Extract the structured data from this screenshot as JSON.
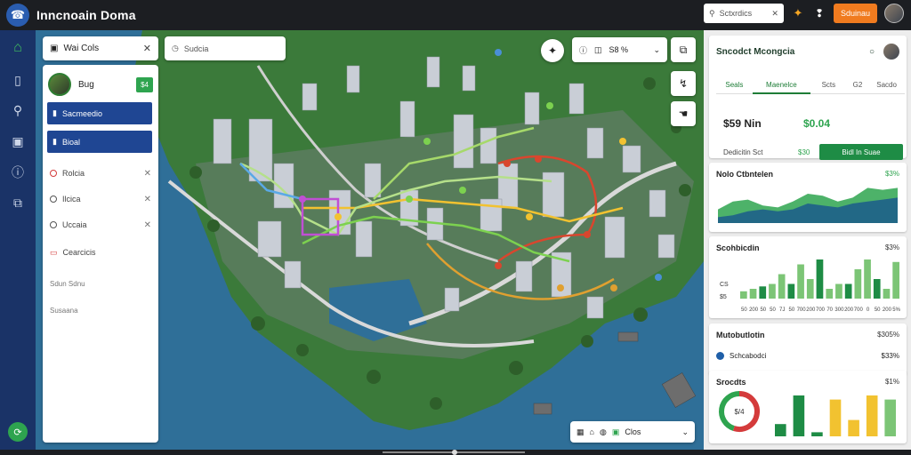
{
  "app": {
    "title": "Inncnoain Doma",
    "logo_icon": "☎"
  },
  "topbar": {
    "search_placeholder": "Sctxrdics",
    "cta_label": "Sduinau",
    "accent": "#f07b1f"
  },
  "rail": {
    "items": [
      {
        "name": "home-icon",
        "glyph": "⌂"
      },
      {
        "name": "book-icon",
        "glyph": "▯"
      },
      {
        "name": "route-icon",
        "glyph": "⚲"
      },
      {
        "name": "wallet-icon",
        "glyph": "▣"
      },
      {
        "name": "info-icon",
        "glyph": "ⓘ"
      },
      {
        "name": "layers-icon",
        "glyph": "⧉"
      }
    ],
    "bottom_glyph": "⟳"
  },
  "tab1": {
    "label": "Wai Cols"
  },
  "tab2": {
    "label": "Sudcia"
  },
  "sidepanel": {
    "user_name": "Bug",
    "user_badge": "$4",
    "nav": [
      "Sacmeedio",
      "Bioal"
    ],
    "layers": [
      "Rolcia",
      "Ilcica",
      "Uccaia"
    ],
    "special_item": "Cearcicis",
    "notes": [
      "Sdun Sdnu",
      "Susaana"
    ]
  },
  "mapctrl": {
    "label": "S8 %"
  },
  "layerbar": {
    "label": "Clos"
  },
  "rightpanel": {
    "title": "Sncodct Mcongcia",
    "tabs": [
      "Seals",
      "Maenelce",
      "Scts",
      "G2",
      "Sacdo"
    ],
    "kpis": {
      "left_value": "$59 Nin",
      "right_value": "$0.04",
      "left_label": "Dedicitin Sct",
      "right_label": "$30"
    },
    "action_label": "Bidl In Suae",
    "area_card": {
      "title": "Nolo Ctbntelen",
      "value": "$3%"
    },
    "bar_card": {
      "title": "Scohbicdin",
      "value": "$3%"
    },
    "mid_card": {
      "title": "Mutobutlotin",
      "value": "$305%",
      "legend_label": "Schcabodci",
      "legend_value": "$33%"
    },
    "donut_card": {
      "title": "Srocdts",
      "value": "$1%",
      "donut_label": "$/4"
    }
  },
  "chart_data": [
    {
      "type": "area",
      "series": [
        {
          "values": [
            0.35,
            0.55,
            0.6,
            0.45,
            0.4,
            0.55,
            0.75,
            0.7,
            0.55,
            0.65,
            0.9,
            0.85,
            0.9
          ]
        },
        {
          "values": [
            0.15,
            0.2,
            0.3,
            0.35,
            0.3,
            0.35,
            0.5,
            0.45,
            0.4,
            0.5,
            0.55,
            0.6,
            0.65
          ]
        }
      ]
    },
    {
      "type": "bar",
      "categories": [
        "50",
        "200",
        "50",
        "50",
        "7J",
        "50",
        "700",
        "200",
        "700",
        "70",
        "300",
        "200",
        "700",
        "0",
        "50",
        "200",
        "5%"
      ],
      "values": [
        3,
        4,
        5,
        6,
        10,
        6,
        14,
        8,
        16,
        4,
        6,
        6,
        12,
        16,
        8,
        4,
        15
      ],
      "side_labels": [
        "CS",
        "$5"
      ]
    },
    {
      "type": "bar",
      "values": [
        3,
        10,
        1,
        9,
        4,
        10,
        9
      ],
      "colors": [
        "#1e8c45",
        "#1e8c45",
        "#1e8c45",
        "#f2c230",
        "#f2c230",
        "#f2c230",
        "#7cc576"
      ]
    },
    {
      "type": "pie",
      "values": [
        55,
        45
      ],
      "colors": [
        "#d43b3b",
        "#2ea44f"
      ]
    }
  ]
}
